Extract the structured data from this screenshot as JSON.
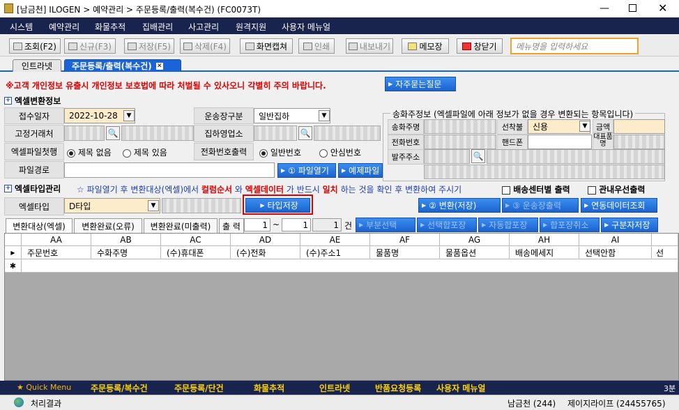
{
  "window": {
    "title": "[남금천] ILOGEN > 예약관리 > 주문등록/출력(복수건) (FC0073T)"
  },
  "menu": [
    "시스템",
    "예약관리",
    "화물추적",
    "집배관리",
    "사고관리",
    "원격지원",
    "사용자 메뉴얼"
  ],
  "toolbar": {
    "search": "조회(F2)",
    "new": "신규(F3)",
    "save": "저장(F5)",
    "delete": "삭제(F4)",
    "capture": "화면캡쳐",
    "print": "인쇄",
    "export": "내보내기",
    "memo": "메모장",
    "close": "창닫기",
    "menu_search_placeholder": "메뉴명을 입력하세요"
  },
  "tabs": {
    "intranet": "인트라넷",
    "current": "주문등록/출력(복수건)"
  },
  "warning": {
    "text": "※고객 개인정보 유출시 개인정보 보호법에 따라 처벌될 수 있사오니 각별히 주의 바랍니다.",
    "faq": "자주묻는질문"
  },
  "excel": {
    "section": "엑셀변환정보",
    "date_label": "접수일자",
    "date_value": "2022-10-28",
    "fare_label": "운송장구분",
    "fare_value": "일반집하",
    "fixed_label": "고정거래처",
    "office_label": "집하영업소",
    "header_label": "엑셀파일첫행",
    "header_opt1": "제목 없음",
    "header_opt2": "제목 있음",
    "phone_label": "전화번호출력",
    "phone_opt1": "일반번호",
    "phone_opt2": "안심번호",
    "path_label": "파일경로",
    "open_btn": "① 파일열기",
    "sample_btn": "예제파일"
  },
  "sender": {
    "title": "송화주정보 (엑셀파일에 아래 정보가 없을 경우 변환되는 항목입니다)",
    "name_label": "송화주명",
    "pay_label": "선착불",
    "pay_value": "신용",
    "amount_label": "금액",
    "tel_label": "전화번호",
    "mobile_label": "핸드폰",
    "rep_label": "대표품명",
    "addr_label": "발주주소"
  },
  "type_mgmt": {
    "section": "엑셀타입관리",
    "notice_a": "☆ 파일열기 후 변환대상(엑셀)에서",
    "notice_b": "컬럼순서",
    "notice_c": "와",
    "notice_d": "엑셀데이터",
    "notice_e": "가 반드시",
    "notice_f": "일치",
    "notice_g": "하는 것을 확인 후 변환하여 주시기",
    "chk1": "배송센터별 출력",
    "chk2": "관내우선출력",
    "type_label": "엑셀타입",
    "type_value": "D타입",
    "save_type": "타입저장",
    "convert": "② 변환(저장)",
    "print_waybill": "③ 운송장출력",
    "linked": "연동데이터조회"
  },
  "result_tabs": [
    "변환대상(엑셀)",
    "변환완료(오류)",
    "변환완료(미출력)"
  ],
  "range": {
    "label": "출 력",
    "from": "1",
    "tilde": "~",
    "to": "1",
    "count": "1",
    "unit": "건"
  },
  "actions": [
    "부분선택",
    "선택합포장",
    "자동합포장",
    "합포장취소",
    "구분자저장"
  ],
  "grid": {
    "letters": [
      "AA",
      "AB",
      "AC",
      "AD",
      "AE",
      "AF",
      "AG",
      "AH",
      "AI"
    ],
    "headers": [
      "주문번호",
      "수화주명",
      "(수)휴대폰",
      "(수)전화",
      "(수)주소1",
      "물품명",
      "물품옵션",
      "배송메세지",
      "선택안함"
    ],
    "extra": "선"
  },
  "bottom_nav": {
    "quick": "Quick Menu",
    "items": [
      "주문등록/복수건",
      "주문등록/단건",
      "화물추적",
      "인트라넷",
      "반품요청등록",
      "사용자 메뉴얼"
    ],
    "right": "3분"
  },
  "status": {
    "result": "처리결과",
    "user": "남금천 (244)",
    "company": "제이지라이프 (24455765)"
  }
}
